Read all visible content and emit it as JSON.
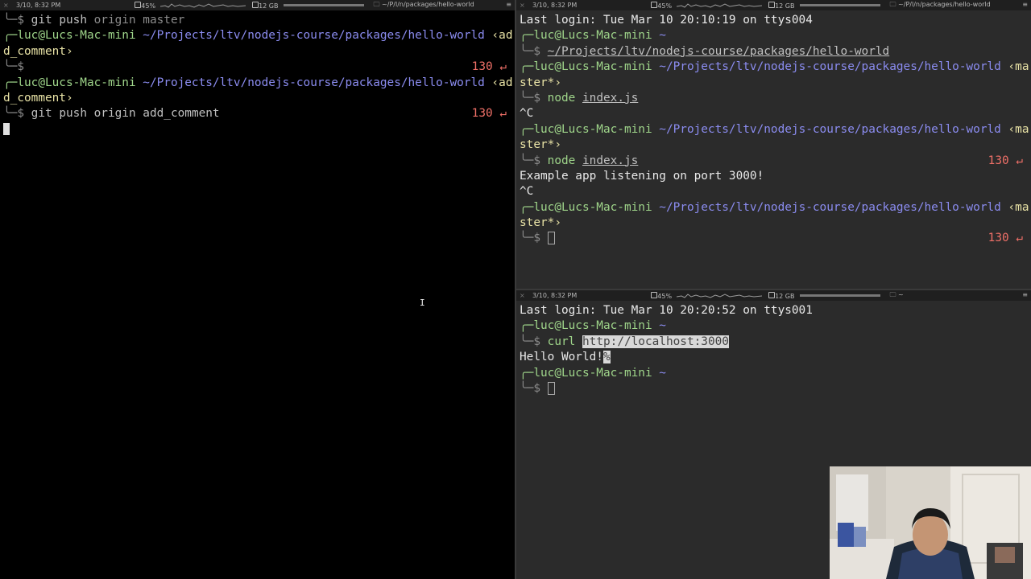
{
  "left_pane": {
    "status": {
      "clock": "3/10, 8:32 PM",
      "cpu": "45%",
      "mem": "12 GB",
      "path": "~/P/l/n/packages/hello-world"
    },
    "lines": [
      {
        "prompt_end": "╰─$",
        "cmd": "git push",
        "args": " origin master"
      },
      {
        "user": "╭─luc@Lucs-Mac-mini",
        "path": " ~/Projects/ltv/nodejs-course/packages/hello-world",
        "branch": " ‹ad"
      },
      {
        "cont": "d_comment›"
      },
      {
        "prompt_end": "╰─$",
        "exit": "130 ↵"
      },
      {
        "user": "╭─luc@Lucs-Mac-mini",
        "path": " ~/Projects/ltv/nodejs-course/packages/hello-world",
        "branch": " ‹ad"
      },
      {
        "cont": "d_comment›"
      },
      {
        "prompt_end": "╰─$",
        "cmd": "git push origin add_comment",
        "exit": "130 ↵"
      }
    ]
  },
  "right_top_pane": {
    "status": {
      "clock": "3/10, 8:32 PM",
      "cpu": "45%",
      "mem": "12 GB",
      "path": "~/P/l/n/packages/hello-world"
    },
    "last_login": "Last login: Tue Mar 10 20:10:19 on ttys004",
    "lines": [
      {
        "user": "╭─luc@Lucs-Mac-mini",
        "path": " ~"
      },
      {
        "prompt_end": "╰─$",
        "ulcmd": "~/Projects/ltv/nodejs-course/packages/hello-world"
      },
      {
        "user": "╭─luc@Lucs-Mac-mini",
        "path": " ~/Projects/ltv/nodejs-course/packages/hello-world",
        "branch": " ‹ma"
      },
      {
        "cont": "ster*›"
      },
      {
        "prompt_end": "╰─$",
        "cmd": "node",
        "file": "index.js"
      },
      {
        "plain": "^C"
      },
      {
        "user": "╭─luc@Lucs-Mac-mini",
        "path": " ~/Projects/ltv/nodejs-course/packages/hello-world",
        "branch": " ‹ma"
      },
      {
        "cont": "ster*›"
      },
      {
        "prompt_end": "╰─$",
        "cmd": "node",
        "file": "index.js",
        "exit": "130 ↵"
      },
      {
        "plain": "Example app listening on port 3000!"
      },
      {
        "plain": "^C"
      },
      {
        "user": "╭─luc@Lucs-Mac-mini",
        "path": " ~/Projects/ltv/nodejs-course/packages/hello-world",
        "branch": " ‹ma"
      },
      {
        "cont": "ster*›"
      },
      {
        "prompt_end": "╰─$",
        "exit": "130 ↵"
      }
    ]
  },
  "right_bottom_pane": {
    "status": {
      "clock": "3/10, 8:32 PM",
      "cpu": "45%",
      "mem": "12 GB",
      "path": "~"
    },
    "last_login": "Last login: Tue Mar 10 20:20:52 on ttys001",
    "user": "╭─luc@Lucs-Mac-mini",
    "home": " ~",
    "prompt_end": "╰─$",
    "curl_cmd": "curl",
    "curl_url": "http://localhost:3000",
    "output": "Hello World!",
    "output_mark": "%"
  },
  "icons": {
    "close": "×",
    "menu": "≡"
  }
}
